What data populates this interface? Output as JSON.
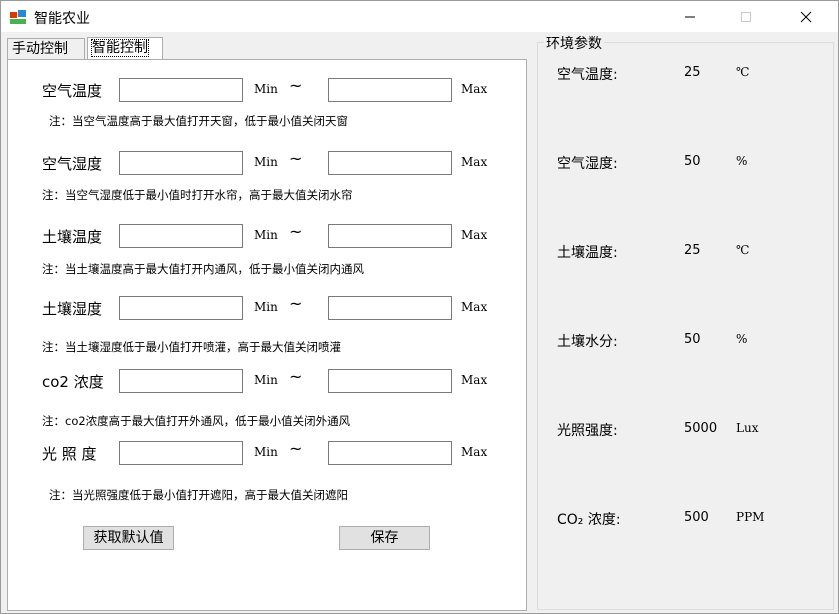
{
  "window": {
    "title": "智能农业"
  },
  "tabs": [
    {
      "label": "手动控制"
    },
    {
      "label": "智能控制"
    }
  ],
  "smart": {
    "rows": [
      {
        "label": "空气温度",
        "min_label": "Min",
        "tilde": "~",
        "max_label": "Max",
        "min_value": "",
        "max_value": "",
        "note": "注：当空气温度高于最大值打开天窗，低于最小值关闭天窗"
      },
      {
        "label": "空气湿度",
        "min_label": "Min",
        "tilde": "~",
        "max_label": "Max",
        "min_value": "",
        "max_value": "",
        "note": "注：当空气湿度低于最小值时打开水帘，高于最大值关闭水帘"
      },
      {
        "label": "土壤温度",
        "min_label": "Min",
        "tilde": "~",
        "max_label": "Max",
        "min_value": "",
        "max_value": "",
        "note": "注：当土壤温度高于最大值打开内通风，低于最小值关闭内通风"
      },
      {
        "label": "土壤湿度",
        "min_label": "Min",
        "tilde": "~",
        "max_label": "Max",
        "min_value": "",
        "max_value": "",
        "note": "注：当土壤湿度低于最小值打开喷灌，高于最大值关闭喷灌"
      },
      {
        "label": "co2 浓度",
        "min_label": "Min",
        "tilde": "~",
        "max_label": "Max",
        "min_value": "",
        "max_value": "",
        "note": "注：co2浓度高于最大值打开外通风，低于最小值关闭外通风"
      },
      {
        "label": "光 照 度",
        "min_label": "Min",
        "tilde": "~",
        "max_label": "Max",
        "min_value": "",
        "max_value": "",
        "note": "注：当光照强度低于最小值打开遮阳，高于最大值关闭遮阳"
      }
    ],
    "get_default_label": "获取默认值",
    "save_label": "保存"
  },
  "env": {
    "title": "环境参数",
    "items": [
      {
        "label": "空气温度:",
        "value": "25",
        "unit": "℃"
      },
      {
        "label": "空气湿度:",
        "value": "50",
        "unit": "%"
      },
      {
        "label": "土壤温度:",
        "value": "25",
        "unit": "℃"
      },
      {
        "label": "土壤水分:",
        "value": "50",
        "unit": "%"
      },
      {
        "label": "光照强度:",
        "value": "5000",
        "unit": "Lux"
      },
      {
        "label": "CO₂ 浓度:",
        "value": "500",
        "unit": "PPM"
      }
    ]
  }
}
